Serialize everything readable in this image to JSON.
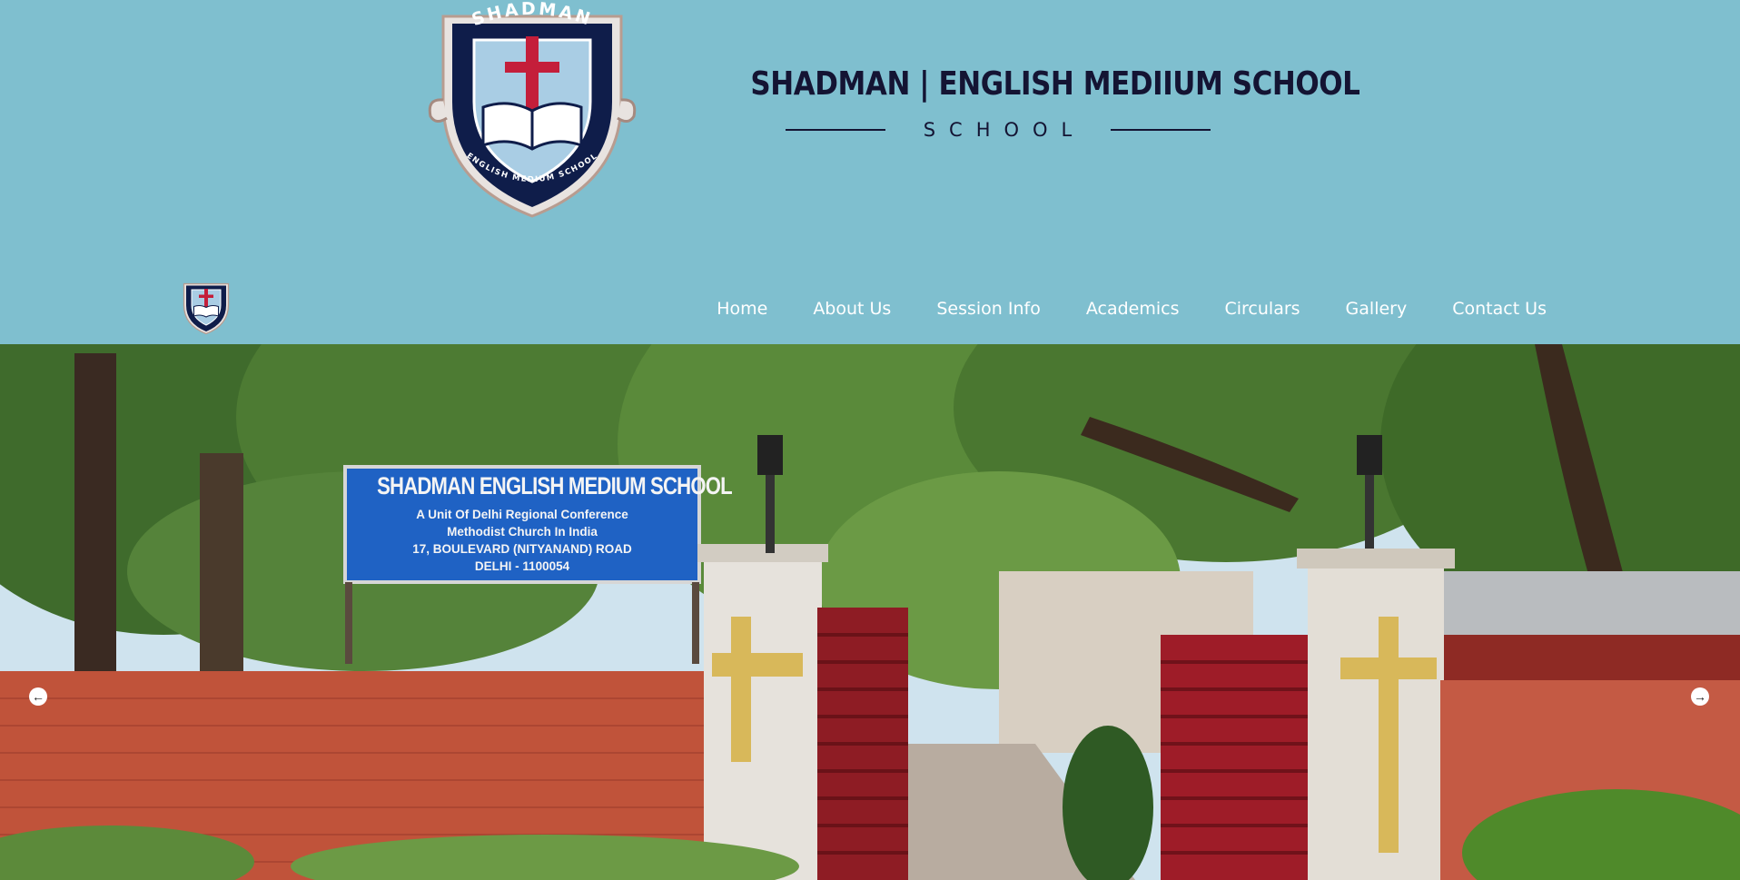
{
  "header": {
    "crest": {
      "ring_top_text": "SHADMAN",
      "ring_bottom_text": "ENGLISH MEDIUM SCHOOL"
    },
    "brand_title": "SHADMAN | ENGLISH MEDIIUM SCHOOL",
    "brand_subtitle": "SCHOOL"
  },
  "nav": {
    "items": [
      {
        "label": "Home"
      },
      {
        "label": "About Us"
      },
      {
        "label": "Session Info"
      },
      {
        "label": "Academics"
      },
      {
        "label": "Circulars"
      },
      {
        "label": "Gallery"
      },
      {
        "label": "Contact Us"
      }
    ]
  },
  "hero": {
    "sign": {
      "title": "SHADMAN ENGLISH MEDIUM SCHOOL",
      "lines": [
        "A Unit Of Delhi Regional Conference",
        "Methodist Church In India",
        "17, BOULEVARD (NITYANAND) ROAD",
        "DELHI - 1100054"
      ]
    },
    "prev_icon": "arrow-left-icon",
    "next_icon": "arrow-right-icon"
  },
  "colors": {
    "background": "#7fbfcf",
    "brand_text": "#141433",
    "nav_text": "#ffffff",
    "crest_navy": "#0f1d4a",
    "crest_red": "#c41e3a"
  }
}
